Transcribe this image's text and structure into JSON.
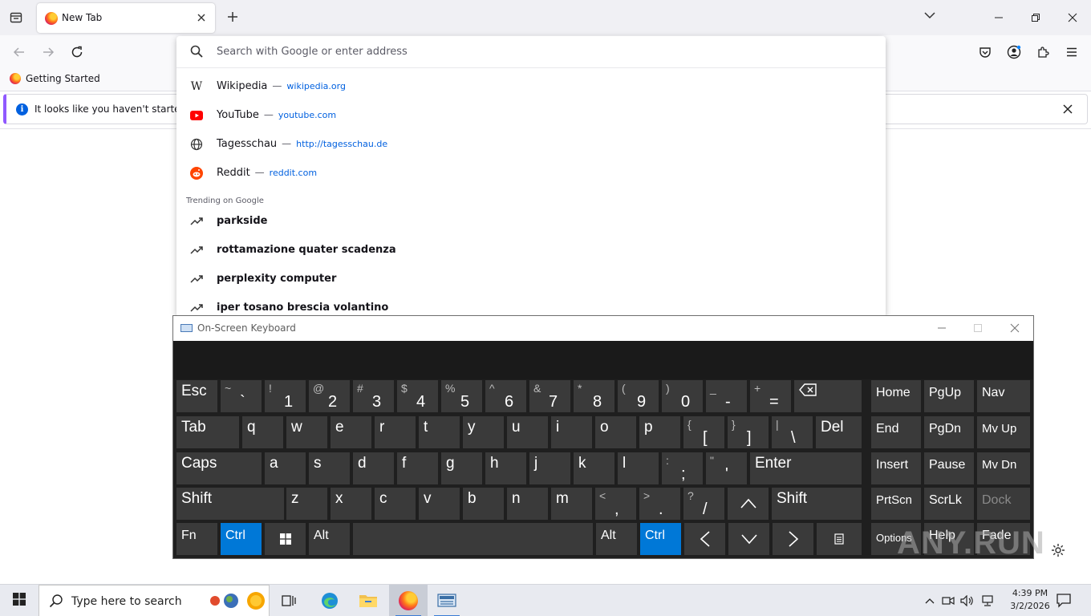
{
  "browser": {
    "tab_title": "New Tab",
    "bookmark": "Getting Started",
    "notice_text": "It looks like you haven't started Fi",
    "urlbar": {
      "placeholder": "Search with Google or enter address",
      "suggestions": [
        {
          "title": "Wikipedia",
          "sep": "—",
          "url": "wikipedia.org",
          "icon": "wikipedia-icon"
        },
        {
          "title": "YouTube",
          "sep": "—",
          "url": "youtube.com",
          "icon": "youtube-icon"
        },
        {
          "title": "Tagesschau",
          "sep": "—",
          "url": "http://tagesschau.de",
          "icon": "globe-icon"
        },
        {
          "title": "Reddit",
          "sep": "—",
          "url": "reddit.com",
          "icon": "reddit-icon"
        }
      ],
      "trending_heading": "Trending on Google",
      "trending": [
        "parkside",
        "rottamazione quater scadenza",
        "perplexity computer",
        "iper tosano brescia volantino"
      ]
    }
  },
  "osk": {
    "title": "On-Screen Keyboard",
    "row1": [
      {
        "main": "Esc"
      },
      {
        "top": "~",
        "bot": "`"
      },
      {
        "top": "!",
        "bot": "1"
      },
      {
        "top": "@",
        "bot": "2"
      },
      {
        "top": "#",
        "bot": "3"
      },
      {
        "top": "$",
        "bot": "4"
      },
      {
        "top": "%",
        "bot": "5"
      },
      {
        "top": "^",
        "bot": "6"
      },
      {
        "top": "&",
        "bot": "7"
      },
      {
        "top": "*",
        "bot": "8"
      },
      {
        "top": "(",
        "bot": "9"
      },
      {
        "top": ")",
        "bot": "0"
      },
      {
        "top": "_",
        "bot": "-"
      },
      {
        "top": "+",
        "bot": "="
      }
    ],
    "row2": [
      {
        "main": "Tab"
      },
      {
        "main": "q"
      },
      {
        "main": "w"
      },
      {
        "main": "e"
      },
      {
        "main": "r"
      },
      {
        "main": "t"
      },
      {
        "main": "y"
      },
      {
        "main": "u"
      },
      {
        "main": "i"
      },
      {
        "main": "o"
      },
      {
        "main": "p"
      },
      {
        "top": "{",
        "bot": "["
      },
      {
        "top": "}",
        "bot": "]"
      },
      {
        "top": "|",
        "bot": "\\"
      },
      {
        "main": "Del"
      }
    ],
    "row3": [
      {
        "main": "Caps"
      },
      {
        "main": "a"
      },
      {
        "main": "s"
      },
      {
        "main": "d"
      },
      {
        "main": "f"
      },
      {
        "main": "g"
      },
      {
        "main": "h"
      },
      {
        "main": "j"
      },
      {
        "main": "k"
      },
      {
        "main": "l"
      },
      {
        "top": ":",
        "bot": ";"
      },
      {
        "top": "\"",
        "bot": "'"
      },
      {
        "main": "Enter"
      }
    ],
    "row4": [
      {
        "main": "Shift"
      },
      {
        "main": "z"
      },
      {
        "main": "x"
      },
      {
        "main": "c"
      },
      {
        "main": "v"
      },
      {
        "main": "b"
      },
      {
        "main": "n"
      },
      {
        "main": "m"
      },
      {
        "top": "<",
        "bot": ","
      },
      {
        "top": ">",
        "bot": "."
      },
      {
        "top": "?",
        "bot": "/"
      },
      {
        "main": "Shift"
      }
    ],
    "row5": [
      {
        "main": "Fn"
      },
      {
        "main": "Ctrl"
      },
      {
        "main": "Alt"
      },
      {
        "main": "Alt"
      },
      {
        "main": "Ctrl"
      }
    ],
    "nav": [
      {
        "main": "Home"
      },
      {
        "main": "PgUp"
      },
      {
        "main": "Nav"
      },
      {
        "main": "End"
      },
      {
        "main": "PgDn"
      },
      {
        "main": "Mv Up"
      },
      {
        "main": "Insert"
      },
      {
        "main": "Pause"
      },
      {
        "main": "Mv Dn"
      },
      {
        "main": "PrtScn"
      },
      {
        "main": "ScrLk"
      },
      {
        "main": "Dock"
      },
      {
        "main": "Options"
      },
      {
        "main": "Help"
      },
      {
        "main": "Fade"
      }
    ]
  },
  "watermark": "ANY.RUN",
  "taskbar": {
    "search_placeholder": "Type here to search",
    "time": "4:39 PM",
    "date": "3/2/2026"
  }
}
